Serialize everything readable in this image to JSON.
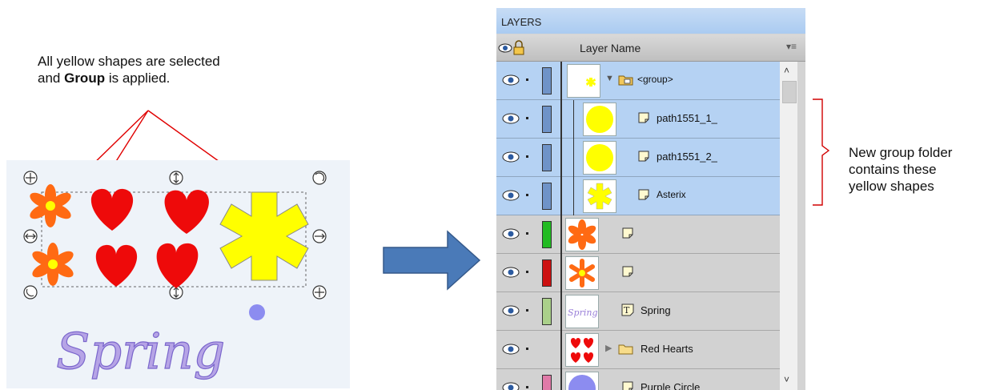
{
  "annotations": {
    "left_line1": "All yellow shapes are selected",
    "left_line2_prefix": "and ",
    "left_line2_bold": "Group",
    "left_line2_suffix": " is applied.",
    "right_line1": "New group folder",
    "right_line2": "contains these",
    "right_line3": "yellow shapes"
  },
  "canvas": {
    "text": "Spring"
  },
  "panel": {
    "title": "LAYERS",
    "column_header": "Layer Name",
    "rows": [
      {
        "label": "<group>",
        "swatch": "#6f93c8",
        "selected": true
      },
      {
        "label": "path1551_1_",
        "swatch": "#6f93c8",
        "selected": true
      },
      {
        "label": "path1551_2_",
        "swatch": "#6f93c8",
        "selected": true
      },
      {
        "label": "Asterix",
        "swatch": "#6f93c8",
        "selected": true
      },
      {
        "label": "",
        "swatch": "#22bb22",
        "selected": false
      },
      {
        "label": "",
        "swatch": "#cc1111",
        "selected": false
      },
      {
        "label": "Spring",
        "swatch": "#aad08a",
        "selected": false
      },
      {
        "label": "Red Hearts",
        "swatch": "",
        "selected": false
      },
      {
        "label": "Purple Circle",
        "swatch": "#e07aa8",
        "selected": false
      }
    ]
  },
  "colors": {
    "yellow": "#ffff00",
    "orange": "#ff6a13",
    "red": "#ee0a0a",
    "purple": "#8c8cf0",
    "arrow_blue": "#4a7ab8",
    "selection_blue": "#b5d2f3"
  }
}
